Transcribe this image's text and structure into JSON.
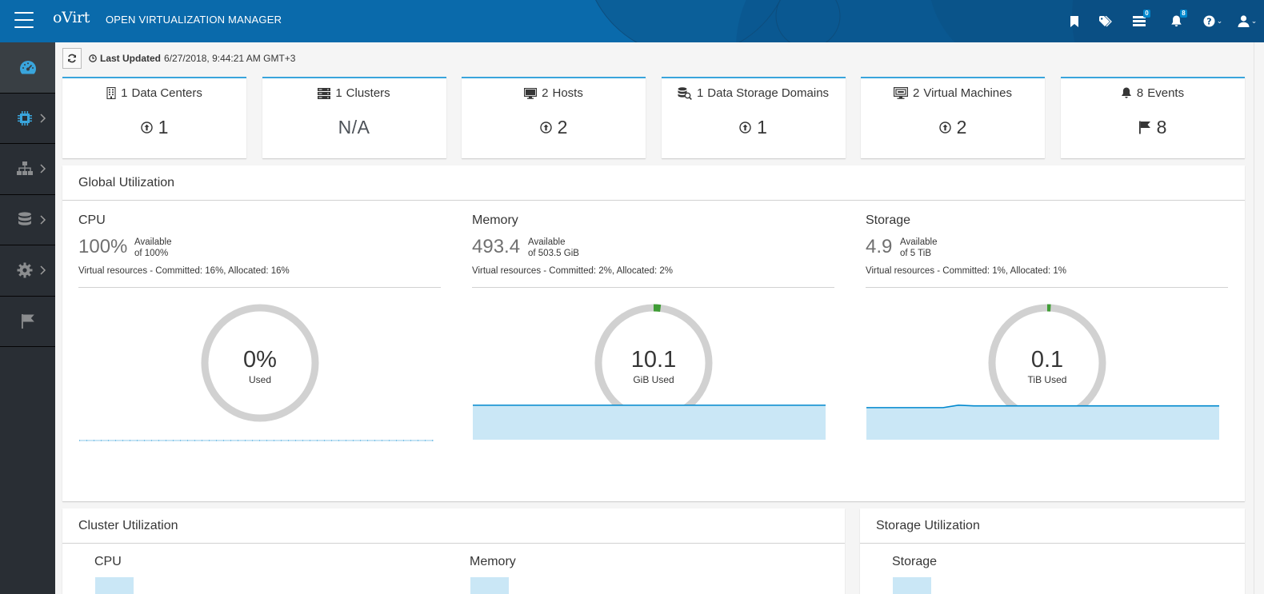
{
  "header": {
    "brand": "oVirt",
    "product": "OPEN VIRTUALIZATION MANAGER",
    "tasks_count": "0",
    "events_count": "8"
  },
  "sidebar": {
    "items": [
      {
        "icon": "dashboard-icon",
        "active": true
      },
      {
        "icon": "compute-icon",
        "active": false
      },
      {
        "icon": "network-icon",
        "active": false
      },
      {
        "icon": "storage-icon",
        "active": false
      },
      {
        "icon": "administration-icon",
        "active": false
      },
      {
        "icon": "events-flag-icon",
        "active": false
      }
    ]
  },
  "updated": {
    "label": "Last Updated",
    "value": "6/27/2018, 9:44:21 AM GMT+3"
  },
  "cards": [
    {
      "count": "1",
      "label": "Data Centers",
      "value": "1",
      "icon": "building-icon",
      "value_icon": "arrow-up-circle-icon"
    },
    {
      "count": "1",
      "label": "Clusters",
      "value": "N/A",
      "icon": "cluster-icon",
      "value_icon": ""
    },
    {
      "count": "2",
      "label": "Hosts",
      "value": "2",
      "icon": "monitor-icon",
      "value_icon": "arrow-up-circle-icon"
    },
    {
      "count": "1",
      "label": "Data Storage Domains",
      "value": "1",
      "icon": "storage-domain-icon",
      "value_icon": "arrow-up-circle-icon"
    },
    {
      "count": "2",
      "label": "Virtual Machines",
      "value": "2",
      "icon": "virtual-machine-icon",
      "value_icon": "arrow-up-circle-icon"
    },
    {
      "count": "8",
      "label": "Events",
      "value": "8",
      "icon": "bell-icon",
      "value_icon": "flag-icon"
    }
  ],
  "global": {
    "title": "Global Utilization",
    "cpu": {
      "title": "CPU",
      "big": "100%",
      "avail_label": "Available",
      "avail_of": "of 100%",
      "virtual": "Virtual resources - Committed: 16%, Allocated: 16%",
      "donut_value": "0%",
      "donut_unit": "Used",
      "used_fraction": 0.0,
      "trend": [
        0,
        0,
        0,
        0,
        0,
        0,
        0,
        0,
        0,
        0,
        0,
        0,
        0,
        0,
        0,
        0,
        0,
        0,
        0,
        0,
        0,
        0,
        0,
        0
      ]
    },
    "memory": {
      "title": "Memory",
      "big": "493.4",
      "avail_label": "Available",
      "avail_of": "of 503.5 GiB",
      "virtual": "Virtual resources - Committed: 2%, Allocated: 2%",
      "donut_value": "10.1",
      "donut_unit": "GiB Used",
      "used_fraction": 0.02,
      "trend": [
        10.1,
        10.1,
        10.1,
        10.1,
        10.1,
        10.1,
        10.1,
        10.1,
        10.1,
        10.1,
        10.1,
        10.1,
        10.1,
        10.1,
        10.1,
        10.1,
        10.1,
        10.1,
        10.1,
        10.1,
        10.1,
        10.1,
        10.1,
        10.1
      ]
    },
    "storage": {
      "title": "Storage",
      "big": "4.9",
      "avail_label": "Available",
      "avail_of": "of 5 TiB",
      "virtual": "Virtual resources - Committed: 1%, Allocated: 1%",
      "donut_value": "0.1",
      "donut_unit": "TiB Used",
      "used_fraction": 0.01,
      "trend": [
        0.093,
        0.093,
        0.093,
        0.093,
        0.093,
        0.093,
        0.1,
        0.098,
        0.098,
        0.098,
        0.098,
        0.098,
        0.098,
        0.098,
        0.098,
        0.098,
        0.098,
        0.098,
        0.098,
        0.098,
        0.098,
        0.098,
        0.098,
        0.098
      ]
    }
  },
  "cluster": {
    "title": "Cluster Utilization",
    "cpu_title": "CPU",
    "memory_title": "Memory"
  },
  "storage_util": {
    "title": "Storage Utilization",
    "storage_title": "Storage"
  },
  "colors": {
    "header": "#0a6aab",
    "sidebar": "#292e34",
    "accent": "#39a5dc",
    "donut_track": "#d1d1d1",
    "donut_used": "#3f9c35",
    "spark_line": "#0088ce",
    "spark_fill": "#cae7f6"
  }
}
